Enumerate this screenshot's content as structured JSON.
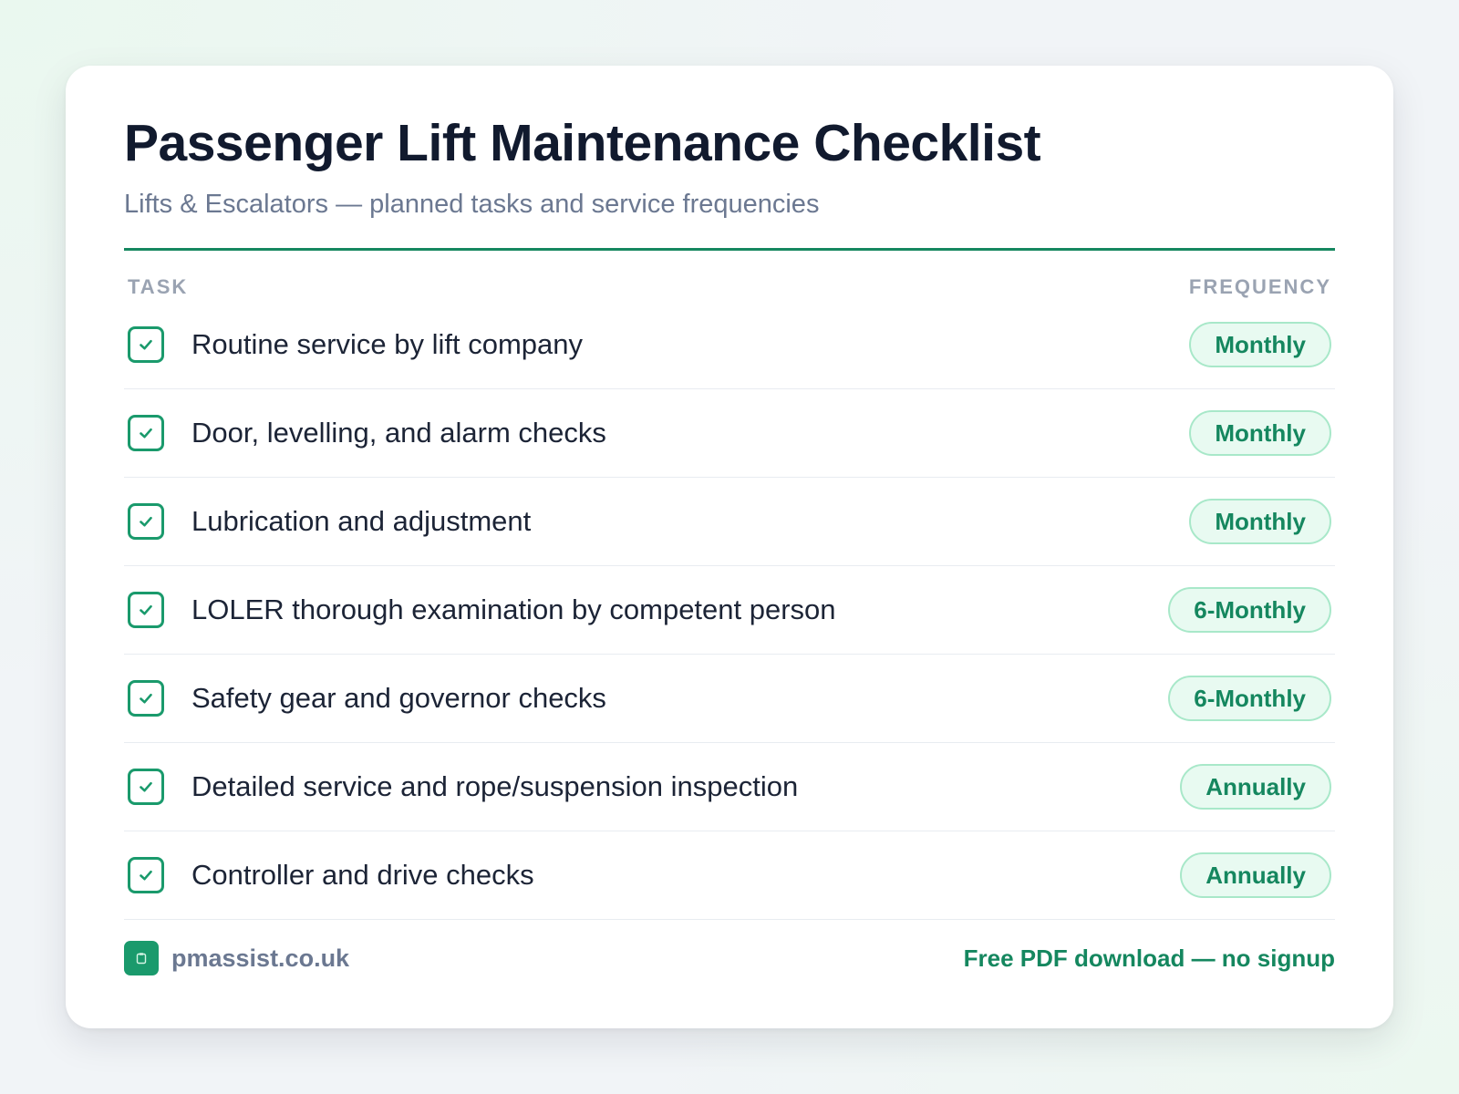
{
  "header": {
    "title": "Passenger Lift Maintenance Checklist",
    "subtitle": "Lifts & Escalators — planned tasks and service frequencies"
  },
  "columns": {
    "task": "TASK",
    "frequency": "FREQUENCY"
  },
  "tasks": [
    {
      "label": "Routine service by lift company",
      "frequency": "Monthly",
      "checked": true
    },
    {
      "label": "Door, levelling, and alarm checks",
      "frequency": "Monthly",
      "checked": true
    },
    {
      "label": "Lubrication and adjustment",
      "frequency": "Monthly",
      "checked": true
    },
    {
      "label": "LOLER thorough examination by competent person",
      "frequency": "6-Monthly",
      "checked": true
    },
    {
      "label": "Safety gear and governor checks",
      "frequency": "6-Monthly",
      "checked": true
    },
    {
      "label": "Detailed service and rope/suspension inspection",
      "frequency": "Annually",
      "checked": true
    },
    {
      "label": "Controller and drive checks",
      "frequency": "Annually",
      "checked": true
    }
  ],
  "footer": {
    "brand": "pmassist.co.uk",
    "brand_icon": "clipboard-icon",
    "cta": "Free PDF download — no signup"
  },
  "colors": {
    "accent": "#15875f",
    "pill_bg": "#e8faf1",
    "pill_border": "#a8e8c9",
    "title": "#111a2e",
    "muted": "#6b7891"
  }
}
